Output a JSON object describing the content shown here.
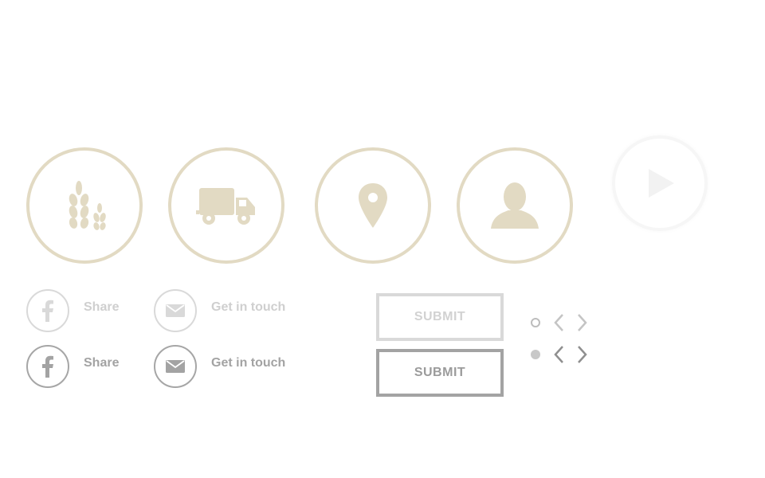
{
  "colors": {
    "beige": "#e2dac3",
    "light_gray": "#d9d9d9",
    "dark_gray": "#a3a3a3"
  },
  "feature_icons": [
    {
      "icon": "wheat-icon"
    },
    {
      "icon": "truck-icon"
    },
    {
      "icon": "location-pin-icon"
    },
    {
      "icon": "person-icon"
    }
  ],
  "video": {
    "icon": "play-icon"
  },
  "share_rows": {
    "light": {
      "share_label": "Share",
      "contact_label": "Get in touch"
    },
    "dark": {
      "share_label": "Share",
      "contact_label": "Get in touch"
    }
  },
  "buttons": {
    "submit_light": "SUBMIT",
    "submit_dark": "SUBMIT"
  }
}
